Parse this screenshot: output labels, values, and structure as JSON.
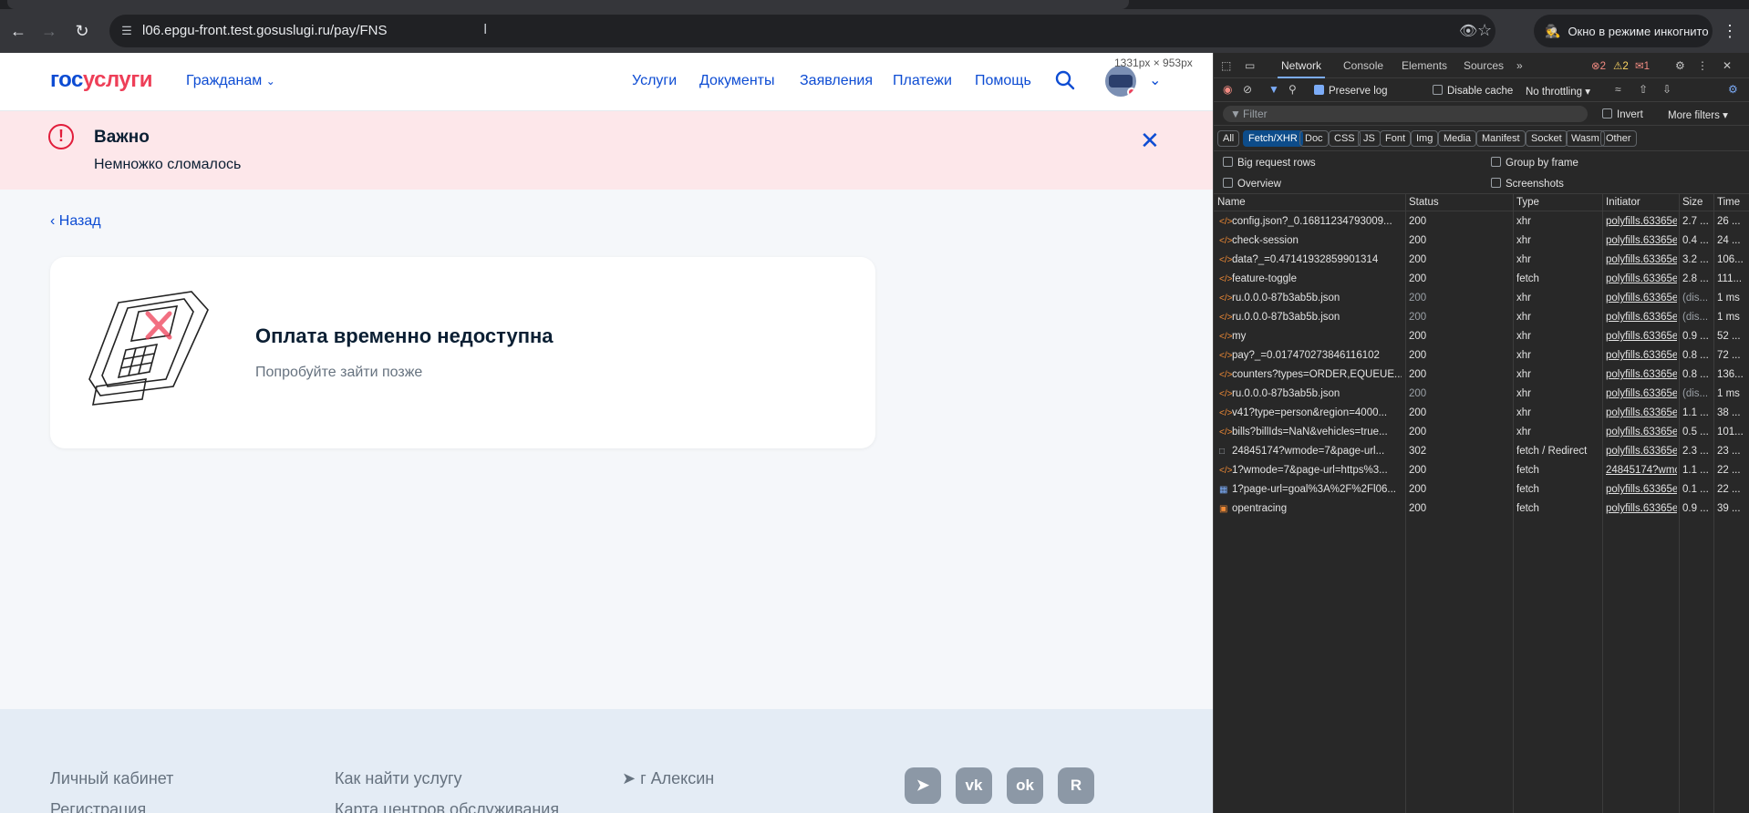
{
  "browser": {
    "url": "l06.epgu-front.test.gosuslugi.ru/pay/FNS",
    "incognito_label": "Окно в режиме инкогнито",
    "viewport_size": "1331px × 953px"
  },
  "header": {
    "logo_part1": "гос",
    "logo_part2": "услуги",
    "citizens": "Гражданам",
    "nav": [
      "Услуги",
      "Документы",
      "Заявления",
      "Платежи",
      "Помощь"
    ]
  },
  "alert": {
    "title": "Важно",
    "text": "Немножко сломалось"
  },
  "back_label": "Назад",
  "card": {
    "title": "Оплата временно недоступна",
    "subtitle": "Попробуйте зайти позже"
  },
  "footer": {
    "col1": [
      "Личный кабинет",
      "Регистрация"
    ],
    "col2": [
      "Как найти услугу",
      "Карта центров обслуживания"
    ],
    "location": "г Алексин",
    "social": [
      "telegram",
      "vk",
      "ok",
      "rutube"
    ]
  },
  "devtools": {
    "tabs": [
      "Network",
      "Console",
      "Elements",
      "Sources"
    ],
    "errors": "2",
    "warnings": "2",
    "issues": "1",
    "preserve_log": "Preserve log",
    "disable_cache": "Disable cache",
    "throttling": "No throttling",
    "filter_placeholder": "Filter",
    "invert": "Invert",
    "more_filters": "More filters",
    "type_chips": [
      "All",
      "Fetch/XHR",
      "Doc",
      "CSS",
      "JS",
      "Font",
      "Img",
      "Media",
      "Manifest",
      "Socket",
      "Wasm",
      "Other"
    ],
    "big_request_rows": "Big request rows",
    "group_by_frame": "Group by frame",
    "overview": "Overview",
    "screenshots": "Screenshots",
    "columns": [
      "Name",
      "Status",
      "Type",
      "Initiator",
      "Size",
      "Time"
    ],
    "requests": [
      {
        "name": "config.json?_0.16811234793009...",
        "status": "200",
        "type": "xhr",
        "initiator": "polyfills.63365e",
        "size": "2.7 ...",
        "time": "26 ...",
        "icon": "xhr"
      },
      {
        "name": "check-session",
        "status": "200",
        "type": "xhr",
        "initiator": "polyfills.63365e",
        "size": "0.4 ...",
        "time": "24 ...",
        "icon": "xhr"
      },
      {
        "name": "data?_=0.47141932859901314",
        "status": "200",
        "type": "xhr",
        "initiator": "polyfills.63365e",
        "size": "3.2 ...",
        "time": "106...",
        "icon": "xhr"
      },
      {
        "name": "feature-toggle",
        "status": "200",
        "type": "fetch",
        "initiator": "polyfills.63365e",
        "size": "2.8 ...",
        "time": "111...",
        "icon": "xhr"
      },
      {
        "name": "ru.0.0.0-87b3ab5b.json",
        "status": "200",
        "type": "xhr",
        "initiator": "polyfills.63365e",
        "size": "(dis...",
        "time": "1 ms",
        "icon": "xhr",
        "dim": true
      },
      {
        "name": "ru.0.0.0-87b3ab5b.json",
        "status": "200",
        "type": "xhr",
        "initiator": "polyfills.63365e",
        "size": "(dis...",
        "time": "1 ms",
        "icon": "xhr",
        "dim": true
      },
      {
        "name": "my",
        "status": "200",
        "type": "xhr",
        "initiator": "polyfills.63365e",
        "size": "0.9 ...",
        "time": "52 ...",
        "icon": "xhr"
      },
      {
        "name": "pay?_=0.017470273846116102",
        "status": "200",
        "type": "xhr",
        "initiator": "polyfills.63365e",
        "size": "0.8 ...",
        "time": "72 ...",
        "icon": "xhr"
      },
      {
        "name": "counters?types=ORDER,EQUEUE...",
        "status": "200",
        "type": "xhr",
        "initiator": "polyfills.63365e",
        "size": "0.8 ...",
        "time": "136...",
        "icon": "xhr"
      },
      {
        "name": "ru.0.0.0-87b3ab5b.json",
        "status": "200",
        "type": "xhr",
        "initiator": "polyfills.63365e",
        "size": "(dis...",
        "time": "1 ms",
        "icon": "xhr",
        "dim": true
      },
      {
        "name": "v41?type=person&region=4000...",
        "status": "200",
        "type": "xhr",
        "initiator": "polyfills.63365e",
        "size": "1.1 ...",
        "time": "38 ...",
        "icon": "xhr"
      },
      {
        "name": "bills?billIds=NaN&vehicles=true...",
        "status": "200",
        "type": "xhr",
        "initiator": "polyfills.63365e",
        "size": "0.5 ...",
        "time": "101...",
        "icon": "xhr"
      },
      {
        "name": "24845174?wmode=7&page-url...",
        "status": "302",
        "type": "fetch / Redirect",
        "initiator": "polyfills.63365e",
        "size": "2.3 ...",
        "time": "23 ...",
        "icon": "doc"
      },
      {
        "name": "1?wmode=7&page-url=https%3...",
        "status": "200",
        "type": "fetch",
        "initiator": "24845174?wmc",
        "size": "1.1 ...",
        "time": "22 ...",
        "icon": "xhr"
      },
      {
        "name": "1?page-url=goal%3A%2F%2Fl06...",
        "status": "200",
        "type": "fetch",
        "initiator": "polyfills.63365e",
        "size": "0.1 ...",
        "time": "22 ...",
        "icon": "img"
      },
      {
        "name": "opentracing",
        "status": "200",
        "type": "fetch",
        "initiator": "polyfills.63365e",
        "size": "0.9 ...",
        "time": "39 ...",
        "icon": "trace"
      }
    ]
  }
}
